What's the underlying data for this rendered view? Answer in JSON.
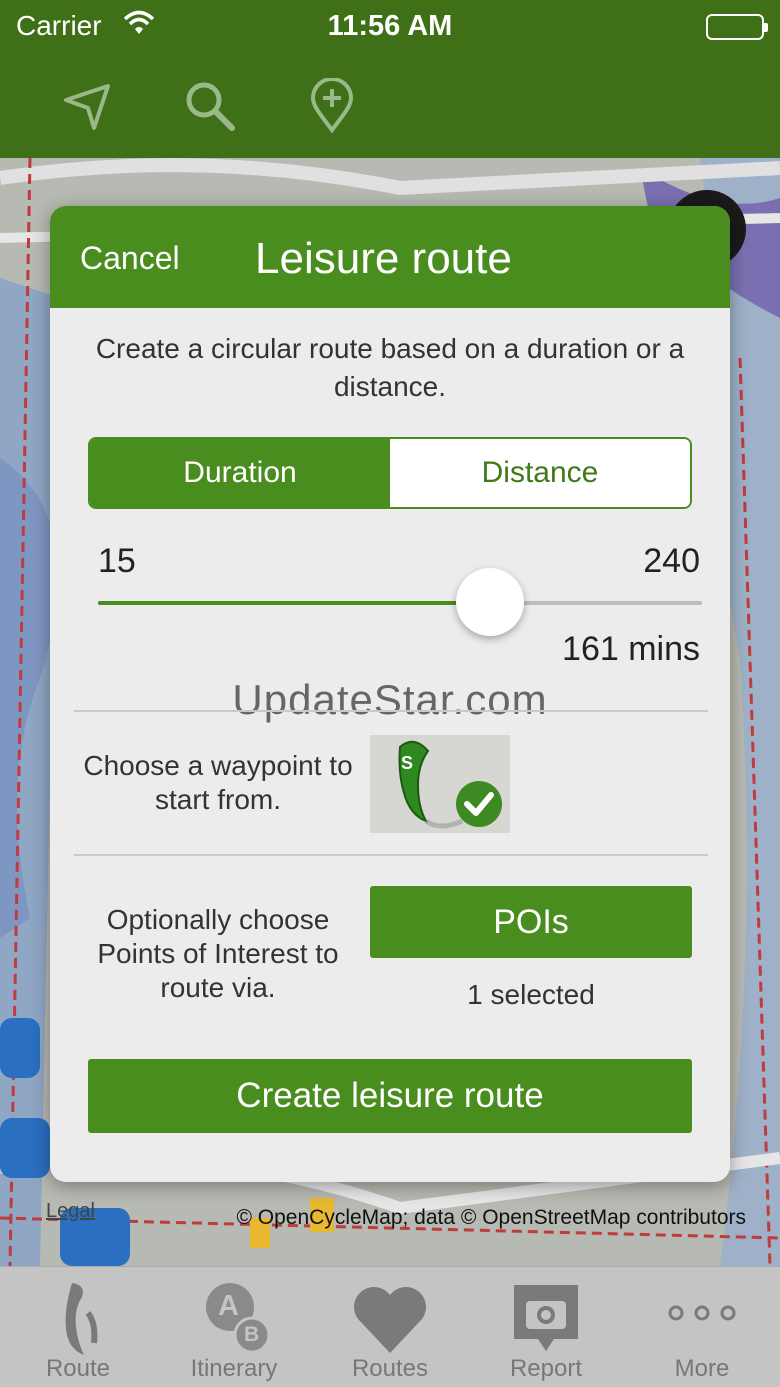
{
  "status_bar": {
    "carrier": "Carrier",
    "time": "11:56 AM"
  },
  "toolbar": {
    "icons": [
      "location-arrow-icon",
      "search-icon",
      "add-pin-icon"
    ]
  },
  "map": {
    "legal_link": "Legal",
    "attribution": "© OpenCycleMap; data © OpenStreetMap contributors"
  },
  "dialog": {
    "cancel_label": "Cancel",
    "title": "Leisure route",
    "description": "Create a circular route based on a duration or a distance.",
    "segments": {
      "duration": "Duration",
      "distance": "Distance",
      "selected": "Duration"
    },
    "slider": {
      "min_label": "15",
      "max_label": "240",
      "min": 15,
      "max": 240,
      "value": 161,
      "value_label": "161 mins"
    },
    "watermark": "UpdateStar.com",
    "waypoint": {
      "label": "Choose a waypoint to start from.",
      "pin_letter": "S"
    },
    "poi": {
      "label": "Optionally choose Points of Interest to route via.",
      "button_label": "POIs",
      "count_label": "1 selected"
    },
    "create_label": "Create leisure route"
  },
  "tab_bar": {
    "tabs": [
      {
        "label": "Route",
        "icon": "route-icon"
      },
      {
        "label": "Itinerary",
        "icon": "itinerary-ab-icon",
        "letters": [
          "A",
          "B"
        ]
      },
      {
        "label": "Routes",
        "icon": "heart-icon"
      },
      {
        "label": "Report",
        "icon": "camera-report-icon"
      },
      {
        "label": "More",
        "icon": "more-dots-icon"
      }
    ]
  },
  "colors": {
    "primary_green": "#4a8d1f",
    "header_green": "#3f6f16",
    "dialog_bg": "#ececec",
    "tab_bg": "#c4c4c4"
  }
}
